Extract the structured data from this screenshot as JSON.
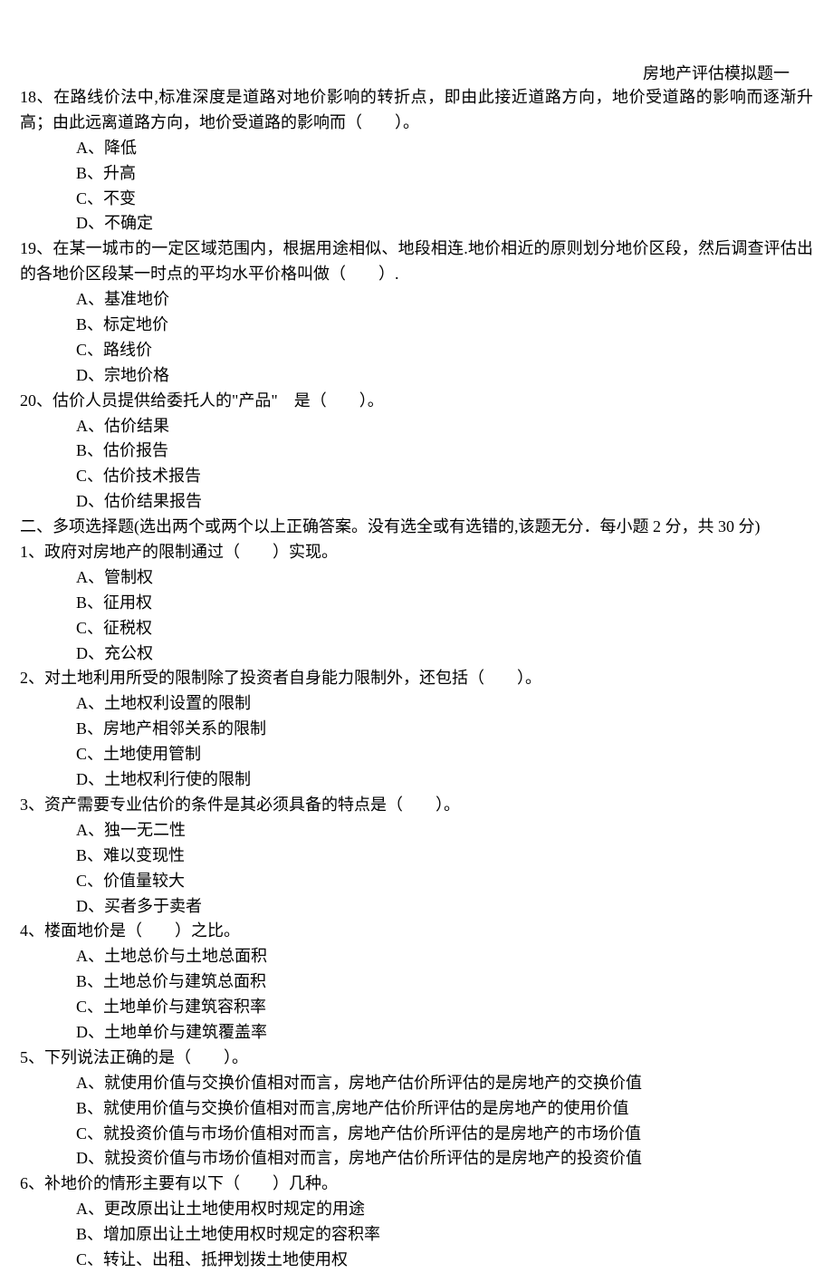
{
  "header_note": "房地产评估模拟题一",
  "questions_single": [
    {
      "num": "18、",
      "stem": "在路线价法中,标准深度是道路对地价影响的转折点，即由此接近道路方向，地价受道路的影响而逐渐升高；由此远离道路方向，地价受道路的影响而（　　）。",
      "options": [
        "A、降低",
        "B、升高",
        "C、不变",
        "D、不确定"
      ]
    },
    {
      "num": "19、",
      "stem": "在某一城市的一定区域范围内，根据用途相似、地段相连.地价相近的原则划分地价区段，然后调查评估出的各地价区段某一时点的平均水平价格叫做（　　）.",
      "options": [
        "A、基准地价",
        "B、标定地价",
        "C、路线价",
        "D、宗地价格"
      ]
    },
    {
      "num": "20、",
      "stem": "估价人员提供给委托人的\"产品\"　是（　　）。",
      "options": [
        "A、估价结果",
        "B、估价报告",
        "C、估价技术报告",
        "D、估价结果报告"
      ]
    }
  ],
  "section2_title": "二、多项选择题(选出两个或两个以上正确答案。没有选全或有选错的,该题无分．每小题 2 分，共 30 分)",
  "questions_multi": [
    {
      "num": "1、",
      "stem": "政府对房地产的限制通过（　　）实现。",
      "options": [
        "A、管制权",
        "B、征用权",
        "C、征税权",
        "D、充公权"
      ]
    },
    {
      "num": "2、",
      "stem": "对土地利用所受的限制除了投资者自身能力限制外，还包括（　　）。",
      "options": [
        "A、土地权利设置的限制",
        "B、房地产相邻关系的限制",
        "C、土地使用管制",
        "D、土地权利行使的限制"
      ]
    },
    {
      "num": "3、",
      "stem": "资产需要专业估价的条件是其必须具备的特点是（　　）。",
      "options": [
        "A、独一无二性",
        "B、难以变现性",
        "C、价值量较大",
        "D、买者多于卖者"
      ]
    },
    {
      "num": "4、",
      "stem": "楼面地价是（　　）之比。",
      "options": [
        "A、土地总价与土地总面积",
        "B、土地总价与建筑总面积",
        "C、土地单价与建筑容积率",
        "D、土地单价与建筑覆盖率"
      ]
    },
    {
      "num": "5、",
      "stem": "下列说法正确的是（　　）。",
      "options": [
        "A、就使用价值与交换价值相对而言，房地产估价所评估的是房地产的交换价值",
        "B、就使用价值与交换价值相对而言,房地产估价所评估的是房地产的使用价值",
        "C、就投资价值与市场价值相对而言，房地产估价所评估的是房地产的市场价值",
        "D、就投资价值与市场价值相对而言，房地产估价所评估的是房地产的投资价值"
      ]
    },
    {
      "num": "6、",
      "stem": "补地价的情形主要有以下（　　）几种。",
      "options": [
        "A、更改原出让土地使用权时规定的用途",
        "B、增加原出让土地使用权时规定的容积率",
        "C、转让、出租、抵押划拨土地使用权"
      ]
    }
  ]
}
